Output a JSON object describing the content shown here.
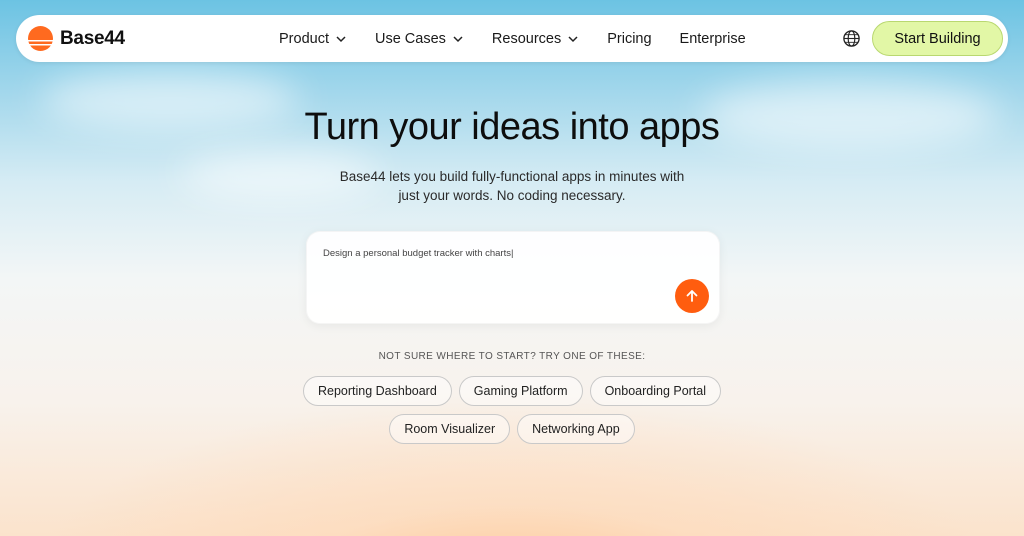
{
  "brand": {
    "name": "Base44",
    "accent": "#ff5d0f"
  },
  "nav": {
    "items": [
      {
        "label": "Product",
        "dropdown": true
      },
      {
        "label": "Use Cases",
        "dropdown": true
      },
      {
        "label": "Resources",
        "dropdown": true
      },
      {
        "label": "Pricing",
        "dropdown": false
      },
      {
        "label": "Enterprise",
        "dropdown": false
      }
    ],
    "language_icon": "globe-icon",
    "cta_label": "Start Building",
    "cta_color": "#e2f7a6"
  },
  "hero": {
    "title": "Turn your ideas into apps",
    "subtitle_line1": "Base44 lets you build fully-functional apps in minutes with",
    "subtitle_line2": "just your words. No coding necessary."
  },
  "prompt": {
    "value": "Design a personal budget tracker with charts|",
    "send_icon": "arrow-up-icon"
  },
  "suggestions": {
    "label": "NOT SURE WHERE TO START? TRY ONE OF THESE:",
    "row1": [
      "Reporting Dashboard",
      "Gaming Platform",
      "Onboarding Portal"
    ],
    "row2": [
      "Room Visualizer",
      "Networking App"
    ]
  }
}
